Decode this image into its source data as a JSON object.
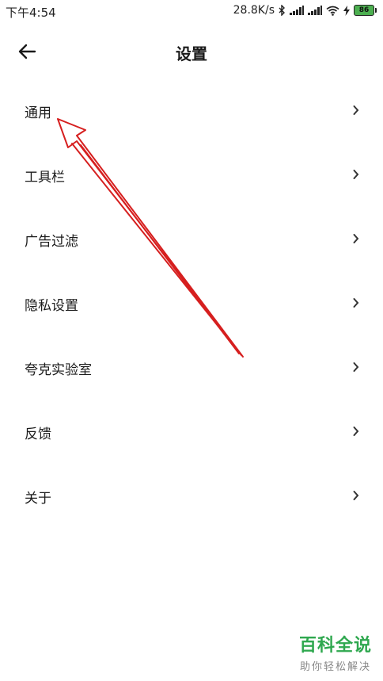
{
  "status_bar": {
    "time": "下午4:54",
    "net_speed": "28.8K/s",
    "battery": "86",
    "icons": [
      "bluetooth-icon",
      "signal-icon",
      "signal-icon",
      "wifi-icon",
      "charging-icon",
      "battery-icon"
    ]
  },
  "header": {
    "back_icon": "arrow-left-icon",
    "title": "设置"
  },
  "menu": {
    "items": [
      {
        "label": "通用"
      },
      {
        "label": "工具栏"
      },
      {
        "label": "广告过滤"
      },
      {
        "label": "隐私设置"
      },
      {
        "label": "夸克实验室"
      },
      {
        "label": "反馈"
      },
      {
        "label": "关于"
      }
    ],
    "chevron_icon": "chevron-right-icon"
  },
  "annotation": {
    "color": "#d61f1f",
    "points_to": "通用"
  },
  "watermark": {
    "title": "百科全说",
    "subtitle": "助你轻松解决",
    "color": "#2fa84f"
  }
}
